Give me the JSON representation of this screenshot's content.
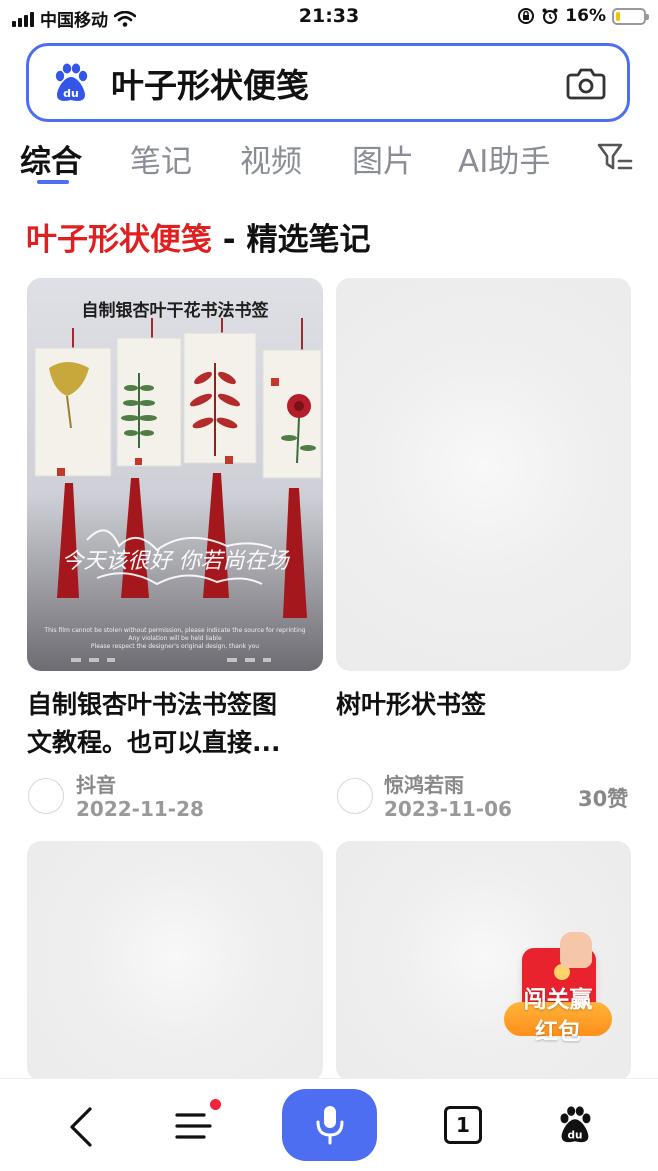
{
  "status_bar": {
    "carrier": "中国移动",
    "time": "21:33",
    "battery_percent": "16%",
    "battery_level": 0.16
  },
  "search": {
    "query": "叶子形状便笺",
    "logo_icon": "baidu-paw-icon",
    "camera_icon": "camera-icon"
  },
  "tabs": [
    {
      "label": "综合",
      "active": true
    },
    {
      "label": "笔记",
      "active": false
    },
    {
      "label": "视频",
      "active": false
    },
    {
      "label": "图片",
      "active": false
    },
    {
      "label": "AI助手",
      "active": false
    }
  ],
  "section": {
    "keyword": "叶子形状便笺",
    "suffix": " - 精选笔记"
  },
  "cards": [
    {
      "title_line1": "自制银杏叶书法书签图",
      "title_line2": "文教程。也可以直接...",
      "author": "抖音",
      "date": "2022-11-28",
      "likes": "",
      "image_text": "自制银杏叶干花书法书签",
      "image_script": "今天该很好 你若尚在场",
      "image_footer_1": "This film cannot be stolen without permission, please indicate the source for reprinting",
      "image_footer_2": "Any violation will be held liable",
      "image_footer_3": "Please respect the designer's original design, thank you"
    },
    {
      "title_line1": "树叶形状书签",
      "author": "惊鸿若雨",
      "date": "2023-11-06",
      "likes": "30赞"
    }
  ],
  "promo": {
    "line1": "闯关赢",
    "line2": "红包"
  },
  "bottom_nav": {
    "tab_count": "1",
    "colors": {
      "accent": "#4e6ef2",
      "dot": "#f5213d"
    }
  },
  "colors": {
    "accent": "#4e6ef2",
    "keyword_red": "#e02020",
    "muted": "#8a8d95"
  }
}
